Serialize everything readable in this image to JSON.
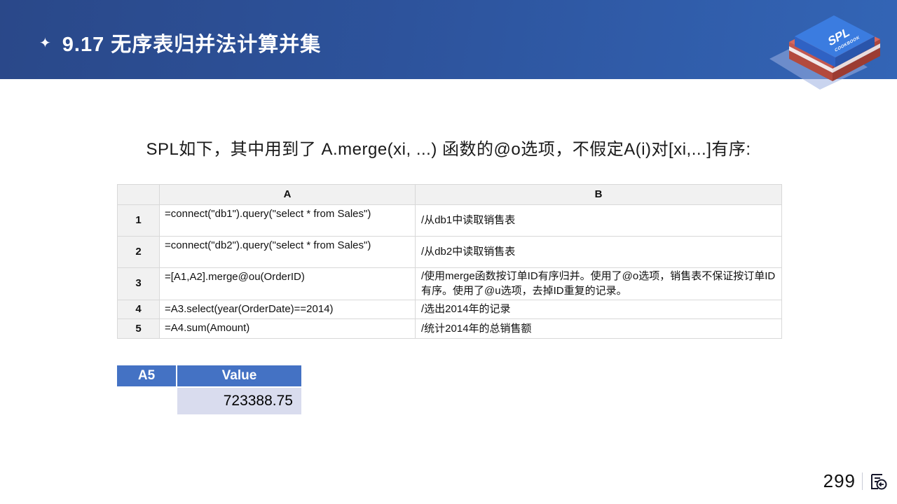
{
  "slide": {
    "header": {
      "star_icon": "✦",
      "title": "9.17 无序表归并法计算并集",
      "book": {
        "title": "SPL",
        "subtitle": "COOKBOOK"
      }
    },
    "subtitle": "SPL如下，其中用到了 A.merge(xi, ...) 函数的@o选项，不假定A(i)对[xi,...]有序:",
    "code_table": {
      "columns": {
        "num": "",
        "a": "A",
        "b": "B"
      },
      "rows": [
        {
          "num": "1",
          "a": "=connect(\"db1\").query(\"select * from Sales\")",
          "b": "/从db1中读取销售表"
        },
        {
          "num": "2",
          "a": "=connect(\"db2\").query(\"select * from Sales\")",
          "b": "/从db2中读取销售表"
        },
        {
          "num": "3",
          "a": "=[A1,A2].merge@ou(OrderID)",
          "b": "/使用merge函数按订单ID有序归并。使用了@o选项，销售表不保证按订单ID有序。使用了@u选项，去掉ID重复的记录。"
        },
        {
          "num": "4",
          "a": "=A3.select(year(OrderDate)==2014)",
          "b": "/选出2014年的记录"
        },
        {
          "num": "5",
          "a": "=A4.sum(Amount)",
          "b": "/统计2014年的总销售额"
        }
      ]
    },
    "result_table": {
      "cell_ref": "A5",
      "value_header": "Value",
      "value": "723388.75"
    },
    "footer": {
      "page_number": "299"
    },
    "colors": {
      "header_gradient_start": "#2a4889",
      "header_gradient_end": "#3365b6",
      "result_header_blue": "#4472c4",
      "result_value_bg": "#d9dcee",
      "book_blue": "#3b7ce0",
      "book_red": "#c4584f"
    }
  }
}
